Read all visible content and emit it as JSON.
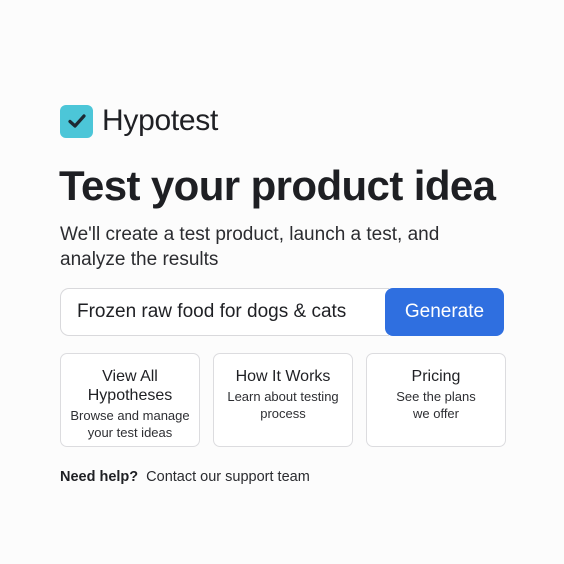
{
  "brand": {
    "name": "Hypotest",
    "icon": "checkmark-icon",
    "icon_color": "#4cc6d8"
  },
  "hero": {
    "title": "Test your product idea",
    "subtitle": "We'll create a test product, launch a test, and analyze the results"
  },
  "search": {
    "value": "Frozen raw food for dogs & cats",
    "button_label": "Generate",
    "button_color": "#2f6fe0"
  },
  "cards": [
    {
      "title": "View All Hypotheses",
      "description": "Browse and manage your test ideas"
    },
    {
      "title": "How It Works",
      "description": "Learn about testing process"
    },
    {
      "title": "Pricing",
      "description": "See the plans we offer"
    }
  ],
  "help": {
    "label": "Need help?",
    "link": "Contact our support team"
  }
}
